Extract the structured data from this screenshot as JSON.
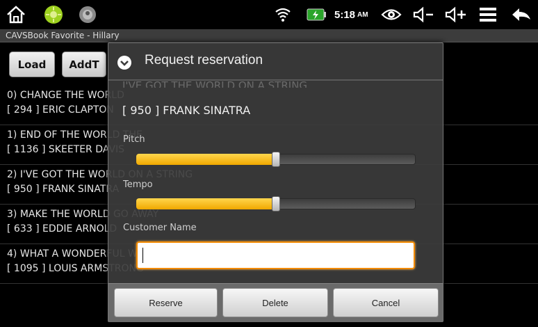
{
  "status_bar": {
    "time": "5:18",
    "ampm": "AM",
    "icons": [
      "home-icon",
      "android-app-icon",
      "app-icon",
      "wifi-icon",
      "battery-icon",
      "eye-icon",
      "volume-down-icon",
      "volume-up-icon",
      "menu-icon",
      "back-icon"
    ]
  },
  "app": {
    "title": "CAVSBook Favorite - Hillary",
    "buttons": [
      "Load",
      "AddT"
    ],
    "songs": [
      {
        "title": "0) CHANGE THE WORLD",
        "artist": "[ 294 ]  ERIC CLAPTON"
      },
      {
        "title": "1) END OF THE WORLD THE",
        "artist": "[ 1136 ]  SKEETER DAVIS"
      },
      {
        "title": "2) I'VE GOT THE WORLD ON A STRING",
        "artist": "[ 950 ]  FRANK SINATRA"
      },
      {
        "title": "3) MAKE THE WORLD GO AWAY",
        "artist": "[ 633 ]  EDDIE ARNOLD"
      },
      {
        "title": "4) WHAT A WONDERFUL WORLD",
        "artist": "[ 1095 ]  LOUIS ARMSTRONG"
      }
    ]
  },
  "dialog": {
    "title": "Request reservation",
    "scrolled_text": "I'VE GOT THE WORLD ON A STRING",
    "subtitle": "[ 950 ]  FRANK SINATRA",
    "pitch_label": "Pitch",
    "pitch_value": 0.5,
    "tempo_label": "Tempo",
    "tempo_value": 0.5,
    "customer_label": "Customer Name",
    "customer_value": "",
    "buttons": {
      "reserve": "Reserve",
      "delete": "Delete",
      "cancel": "Cancel"
    },
    "accent_color": "#f0a800",
    "focus_color": "#f28a00"
  }
}
